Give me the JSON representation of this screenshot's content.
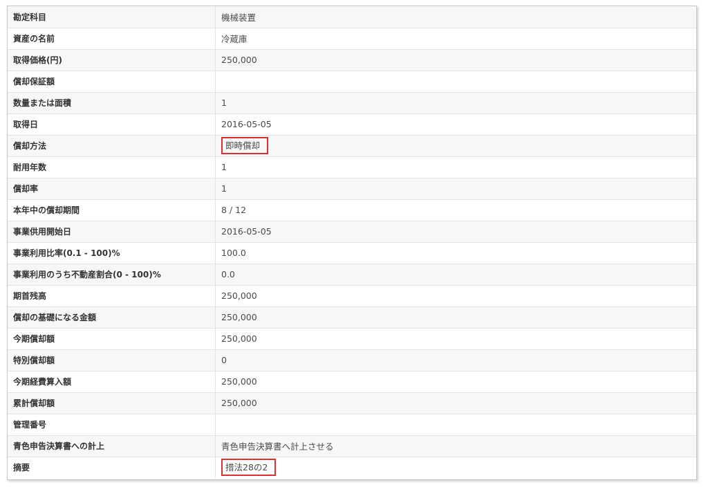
{
  "asset_detail": {
    "rows": [
      {
        "label": "勘定科目",
        "value": "機械装置"
      },
      {
        "label": "資産の名前",
        "value": "冷蔵庫"
      },
      {
        "label": "取得価格(円)",
        "value": "250,000"
      },
      {
        "label": "償却保証額",
        "value": ""
      },
      {
        "label": "数量または面積",
        "value": "1"
      },
      {
        "label": "取得日",
        "value": "2016-05-05"
      },
      {
        "label": "償却方法",
        "value": "即時償却"
      },
      {
        "label": "耐用年数",
        "value": "1"
      },
      {
        "label": "償却率",
        "value": "1"
      },
      {
        "label": "本年中の償却期間",
        "value": "8 / 12"
      },
      {
        "label": "事業供用開始日",
        "value": "2016-05-05"
      },
      {
        "label": "事業利用比率(0.1 - 100)%",
        "value": "100.0"
      },
      {
        "label": "事業利用のうち不動産割合(0 - 100)%",
        "value": "0.0"
      },
      {
        "label": "期首残高",
        "value": "250,000"
      },
      {
        "label": "償却の基礎になる金額",
        "value": "250,000"
      },
      {
        "label": "今期償却額",
        "value": "250,000"
      },
      {
        "label": "特別償却額",
        "value": "0"
      },
      {
        "label": "今期経費算入額",
        "value": "250,000"
      },
      {
        "label": "累計償却額",
        "value": "250,000"
      },
      {
        "label": "管理番号",
        "value": ""
      },
      {
        "label": "青色申告決算書への計上",
        "value": "青色申告決算書へ計上させる"
      },
      {
        "label": "摘要",
        "value": "措法28の2"
      }
    ]
  },
  "colors": {
    "highlight_border": "#d9302f",
    "row_alt": "#f7f7f7",
    "grid_line": "#e3e3e3"
  }
}
